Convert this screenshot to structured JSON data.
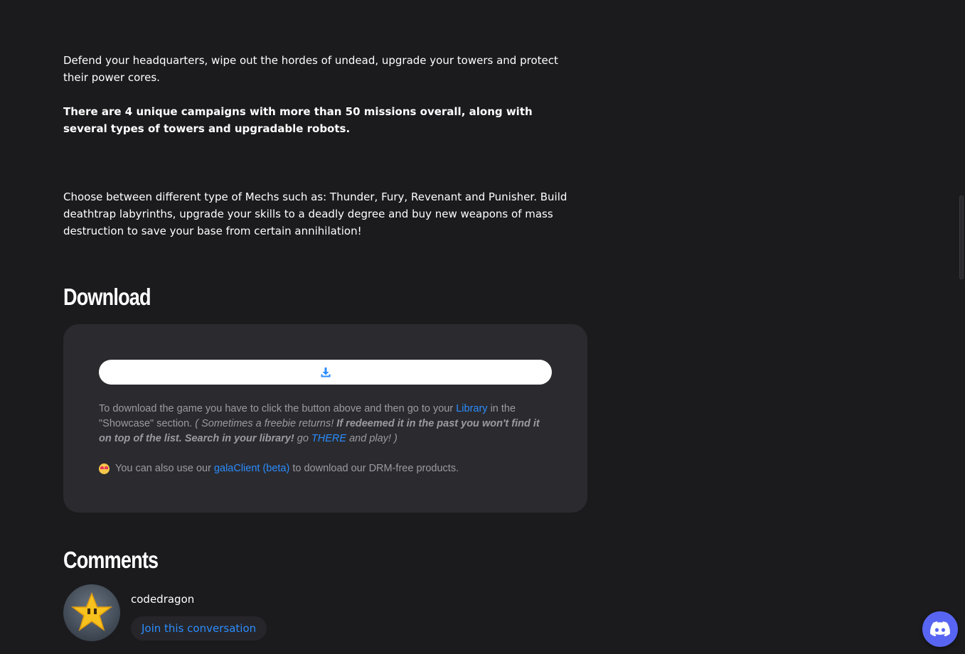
{
  "description": {
    "p1": "Defend your headquarters, wipe out the hordes of undead, upgrade your towers and protect their power cores.",
    "p2": "There are 4 unique campaigns with more than 50 missions overall, along with several types of towers and upgradable robots.",
    "p3": "Choose between different type of Mechs such as: Thunder, Fury, Revenant and Punisher. Build deathtrap labyrinths, upgrade your skills to a deadly degree and buy new weapons of mass destruction to save your base from certain annihilation!"
  },
  "download": {
    "title": "Download",
    "button_icon": "download-icon",
    "info": {
      "part1": "To download the game you have to click the button above and then go to your ",
      "library_link": "Library",
      "part2": " in the \"Showcase\" section. ",
      "italic1": "( Sometimes a freebie returns! ",
      "bold_italic": "If redeemed it in the past you won't find it on top of the list. Search in your library!",
      "italic2": " go ",
      "there_link": "THERE",
      "italic3": " and play! )"
    },
    "client": {
      "emoji_icon": "heart-eyes-emoji-icon",
      "part1": "You can also use our ",
      "link": "galaClient (beta)",
      "part2": " to download our DRM-free products."
    }
  },
  "comments": {
    "title": "Comments",
    "username": "codedragon",
    "join_label": "Join this conversation",
    "avatar_icon": "star-avatar-icon"
  },
  "floating": {
    "discord_icon": "discord-icon"
  },
  "colors": {
    "background": "#1b1b1e",
    "panel": "#2b2b2f",
    "link": "#2b8cff",
    "muted_text": "#9a9aa0",
    "discord": "#5865f2"
  }
}
